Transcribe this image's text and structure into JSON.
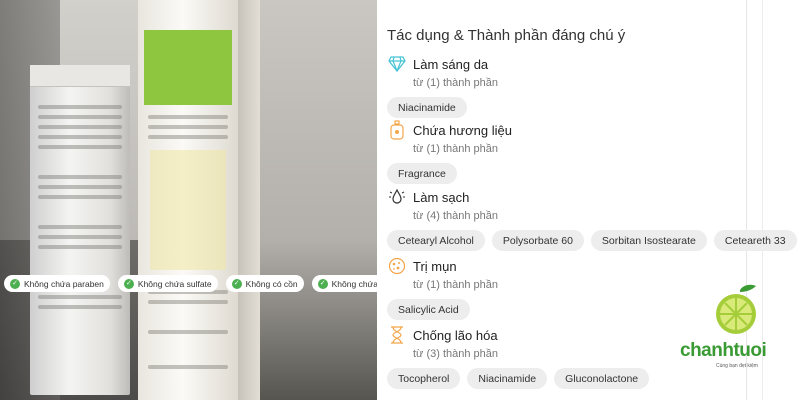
{
  "badges": [
    "Không chứa paraben",
    "Không chứa sulfate",
    "Không có cồn",
    "Không chứa silicone"
  ],
  "panel": {
    "title": "Tác dụng & Thành phần đáng chú ý",
    "groups": [
      {
        "name": "Làm sáng da",
        "sub": "từ (1) thành phần",
        "icon": "diamond-icon",
        "chips": [
          "Niacinamide"
        ]
      },
      {
        "name": "Chứa hương liệu",
        "sub": "từ (1) thành phần",
        "icon": "perfume-bottle-icon",
        "chips": [
          "Fragrance"
        ]
      },
      {
        "name": "Làm sạch",
        "sub": "từ (4) thành phần",
        "icon": "cleanse-drop-icon",
        "chips": [
          "Cetearyl Alcohol",
          "Polysorbate 60",
          "Sorbitan Isostearate",
          "Ceteareth 33"
        ]
      },
      {
        "name": "Trị mụn",
        "sub": "từ (1) thành phần",
        "icon": "acne-icon",
        "chips": [
          "Salicylic Acid"
        ]
      },
      {
        "name": "Chống lão hóa",
        "sub": "từ (3) thành phần",
        "icon": "hourglass-icon",
        "chips": [
          "Tocopherol",
          "Niacinamide",
          "Gluconolactone"
        ]
      }
    ]
  },
  "logo": {
    "name": "chanhtuoi",
    "tagline": "Cùng bạn đẹt kiệm"
  },
  "colors": {
    "accent": "#3a9b34",
    "badge_check": "#4caf50",
    "chip_bg": "#ededed",
    "icon_orange": "#f2a64a",
    "icon_cyan": "#46c3d6"
  }
}
